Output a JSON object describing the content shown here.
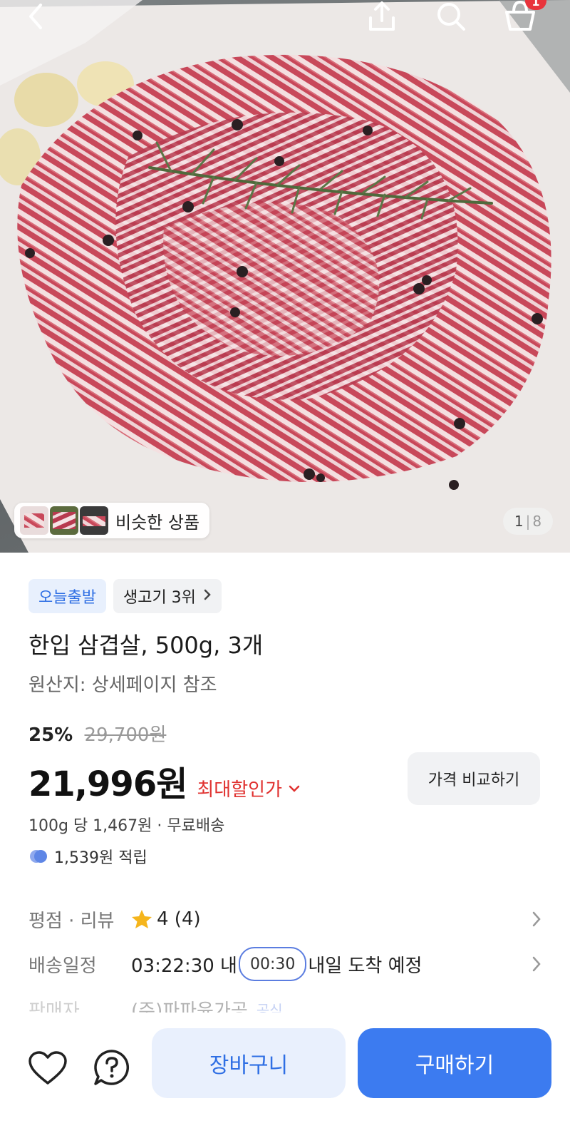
{
  "header": {
    "back_icon": "chevron-left-icon",
    "share_icon": "share-upload-icon",
    "search_icon": "search-icon",
    "cart_icon": "shopping-basket-icon",
    "cart_badge": "1"
  },
  "gallery": {
    "similar_label": "비슷한 상품",
    "current": "1",
    "total": "8"
  },
  "product": {
    "tag_today": "오늘출발",
    "tag_rank": "생고기 3위",
    "title": "한입 삼겹살, 500g, 3개",
    "origin": "원산지: 상세페이지 참조",
    "discount_rate": "25%",
    "original_price": "29,700원",
    "price": "21,996원",
    "max_discount_label": "최대할인가",
    "compare_label": "가격 비교하기",
    "unit_price": "100g 당 1,467원 · 무료배송",
    "points": "1,539원 적립"
  },
  "info": {
    "rating_label": "평점 · 리뷰",
    "rating_value": "4 (4)",
    "delivery_label": "배송일정",
    "delivery_time": "03:22:30 내",
    "delivery_timer": "00:30",
    "delivery_text": "내일 도착 예정",
    "seller_label": "판매자",
    "seller_value": "(주)파파윤가공",
    "seller_badge": "공식"
  },
  "bottom": {
    "wishlist_icon": "heart-icon",
    "inquiry_icon": "question-icon",
    "cart_label": "장바구니",
    "buy_label": "구매하기"
  },
  "colors": {
    "accent_blue": "#3c7bf0",
    "discount_red": "#e0312f",
    "badge_red": "#e8343c"
  }
}
